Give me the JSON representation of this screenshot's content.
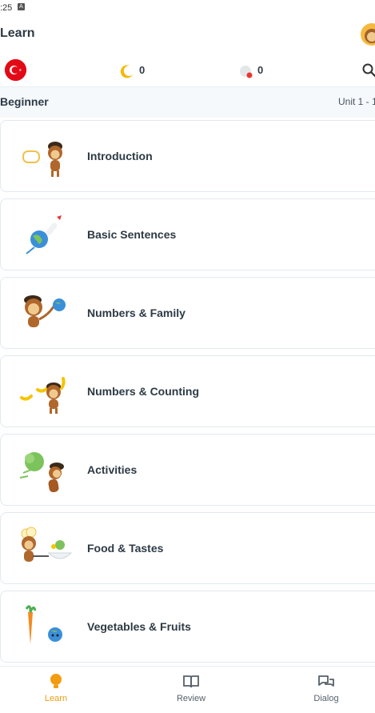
{
  "status": {
    "time": ":25"
  },
  "header": {
    "title": "Learn"
  },
  "stats": {
    "flag_color": "#e30a17",
    "moon_count": "0",
    "gem_count": "0"
  },
  "level": {
    "label": "Beginner",
    "unit_range": "Unit 1 - 1"
  },
  "lessons": [
    {
      "title": "Introduction"
    },
    {
      "title": "Basic Sentences"
    },
    {
      "title": "Numbers & Family"
    },
    {
      "title": "Numbers & Counting"
    },
    {
      "title": "Activities"
    },
    {
      "title": "Food & Tastes"
    },
    {
      "title": "Vegetables & Fruits"
    }
  ],
  "nav": [
    {
      "label": "Learn"
    },
    {
      "label": "Review"
    },
    {
      "label": "Dialog"
    }
  ],
  "colors": {
    "accent": "#f39c12",
    "text": "#2d3a45",
    "card_border": "#e3e9ee"
  }
}
